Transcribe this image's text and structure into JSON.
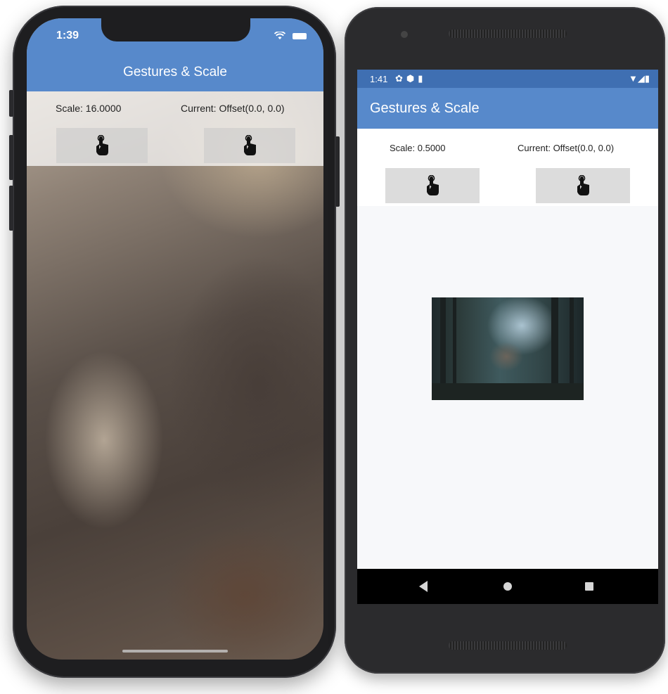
{
  "ios": {
    "status_time": "1:39",
    "app_title": "Gestures & Scale",
    "scale_label": "Scale: 16.0000",
    "offset_label": "Current: Offset(0.0, 0.0)",
    "left_button_icon": "touch-icon",
    "right_button_icon": "touch-icon",
    "status_icons": "wifi-icon battery-icon"
  },
  "android": {
    "status_time": "1:41",
    "status_icons_left": "settings-icon shield-icon sd-card-icon",
    "status_icons_right": "wifi-icon signal-icon battery-icon",
    "app_title": "Gestures & Scale",
    "scale_label": "Scale: 0.5000",
    "offset_label": "Current: Offset(0.0, 0.0)",
    "left_button_icon": "touch-icon",
    "right_button_icon": "touch-icon",
    "nav_buttons": [
      "back-icon",
      "home-icon",
      "recents-icon"
    ]
  },
  "colors": {
    "app_bar": "#5789cb",
    "android_status_bar": "#3f6fb2",
    "button_bg": "#dcdcdc",
    "screen_bg": "#f7f8fa"
  }
}
